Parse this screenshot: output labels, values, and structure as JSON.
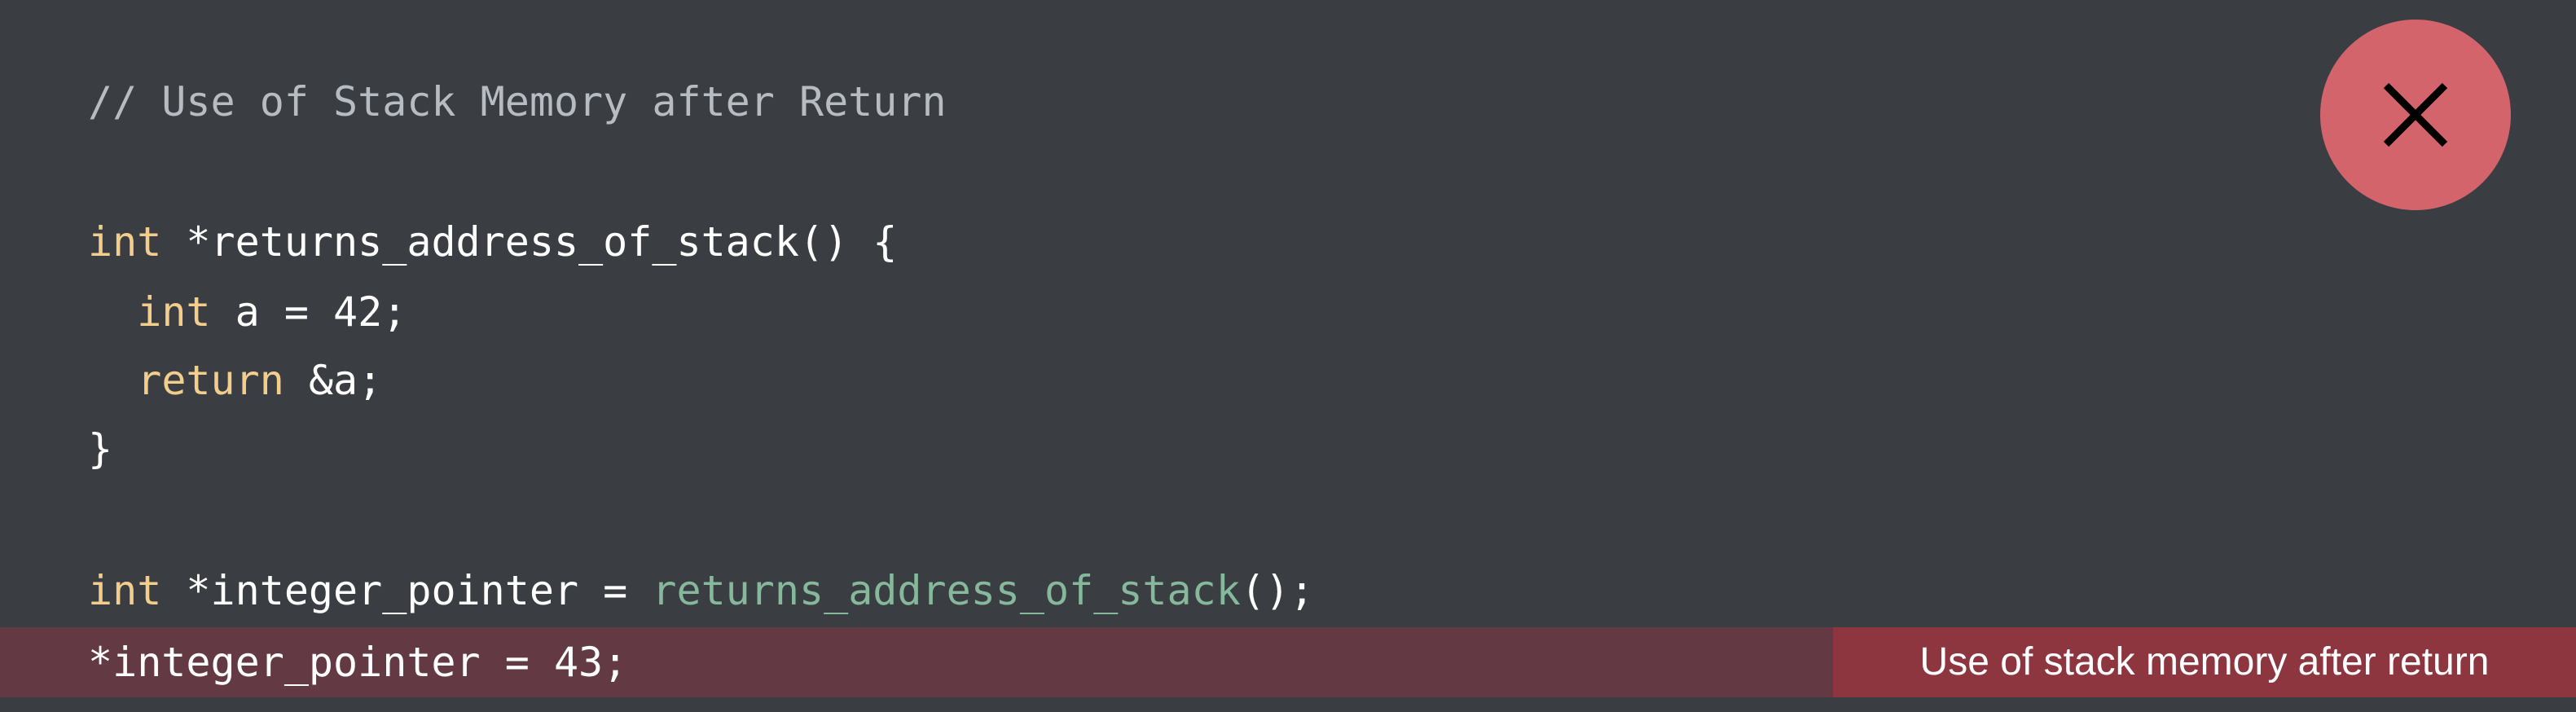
{
  "colors": {
    "background": "#3a3e43",
    "comment": "#b7bcc2",
    "keyword": "#f2cd8c",
    "plain": "#ffffff",
    "function_call": "#86b99b",
    "error_row": "#633a44",
    "error_badge": "#8e3640",
    "close_button": "#d4646c"
  },
  "code": {
    "line1": {
      "comment": "// Use of Stack Memory after Return"
    },
    "line2": {
      "keyword": "int",
      "rest": " *returns_address_of_stack() {"
    },
    "line3": {
      "indent": "  ",
      "keyword": "int",
      "rest": " a = 42;"
    },
    "line4": {
      "indent": "  ",
      "keyword": "return",
      "rest": " &a;"
    },
    "line5": {
      "text": "}"
    },
    "line6": {
      "keyword": "int",
      "middle": " *integer_pointer = ",
      "call": "returns_address_of_stack",
      "end": "();"
    },
    "line7": {
      "text": "*integer_pointer = 43;"
    }
  },
  "error": {
    "message": "Use of stack memory after return"
  },
  "close_button": {
    "icon": "close-icon"
  }
}
